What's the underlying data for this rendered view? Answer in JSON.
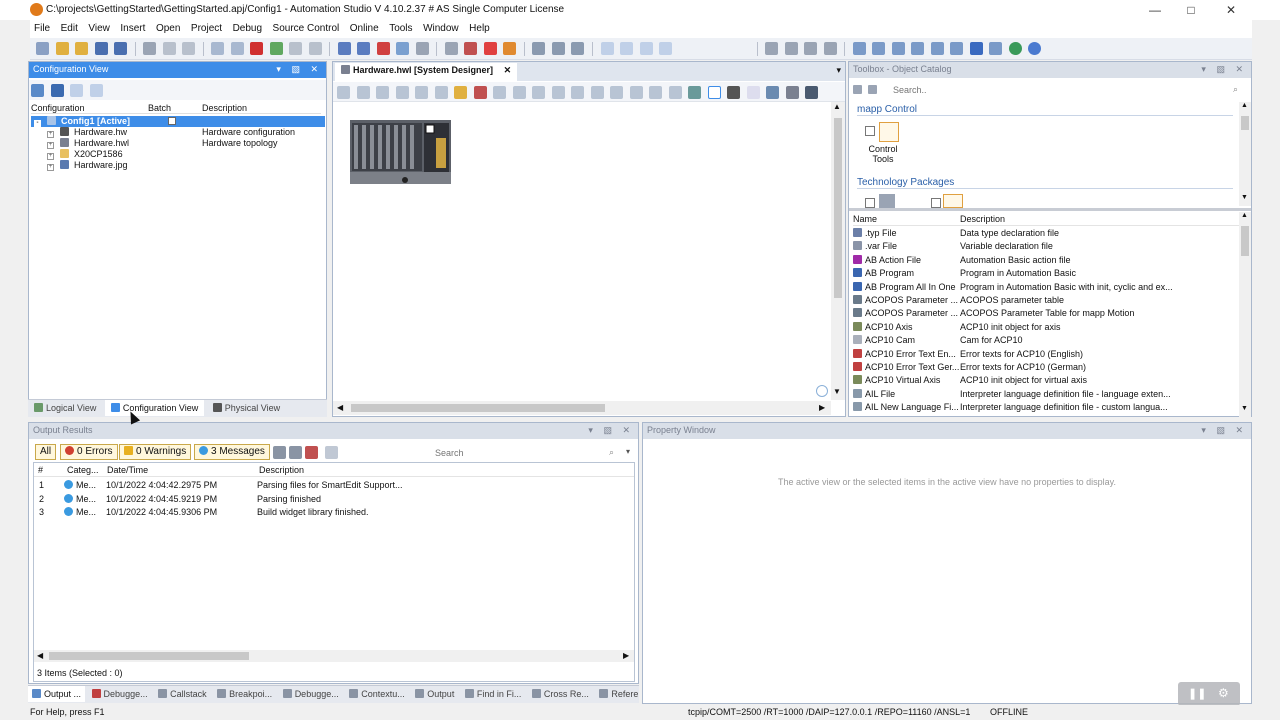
{
  "window": {
    "title": "C:\\projects\\GettingStarted\\GettingStarted.apj/Config1 - Automation Studio V 4.10.2.37 # AS Single Computer License"
  },
  "menu": [
    "File",
    "Edit",
    "View",
    "Insert",
    "Open",
    "Project",
    "Debug",
    "Source Control",
    "Online",
    "Tools",
    "Window",
    "Help"
  ],
  "config_view": {
    "title": "Configuration View",
    "columns": [
      "Configuration",
      "Batch",
      "Description"
    ],
    "rows": [
      {
        "name": "Config1 [Active]",
        "desc": ""
      },
      {
        "name": "Hardware.hw",
        "desc": "Hardware configuration"
      },
      {
        "name": "Hardware.hwl",
        "desc": "Hardware topology"
      },
      {
        "name": "X20CP1586",
        "desc": ""
      },
      {
        "name": "Hardware.jpg",
        "desc": ""
      }
    ],
    "tabs": [
      "Logical View",
      "Configuration View",
      "Physical View"
    ]
  },
  "designer": {
    "tab": "Hardware.hwl [System Designer]"
  },
  "toolbox": {
    "title": "Toolbox - Object Catalog",
    "search_placeholder": "Search..",
    "sections": [
      "mapp Control",
      "Technology Packages"
    ],
    "control_tools_label": "Control Tools",
    "columns": [
      "Name",
      "Description"
    ],
    "items": [
      {
        "name": ".typ File",
        "desc": "Data type declaration file",
        "color": "#6b7fa8"
      },
      {
        "name": ".var File",
        "desc": "Variable declaration file",
        "color": "#8a94a8"
      },
      {
        "name": "AB Action File",
        "desc": "Automation Basic action file",
        "color": "#a02aa8"
      },
      {
        "name": "AB Program",
        "desc": "Program in Automation Basic",
        "color": "#3a66b0"
      },
      {
        "name": "AB Program All In One",
        "desc": "Program in Automation Basic with init, cyclic and ex...",
        "color": "#3a66b0"
      },
      {
        "name": "ACOPOS Parameter ...",
        "desc": "ACOPOS parameter table",
        "color": "#6a7a8a"
      },
      {
        "name": "ACOPOS Parameter ...",
        "desc": "ACOPOS Parameter Table for mapp Motion",
        "color": "#6a7a8a"
      },
      {
        "name": "ACP10 Axis",
        "desc": "ACP10 init object for axis",
        "color": "#7a8a5a"
      },
      {
        "name": "ACP10 Cam",
        "desc": "Cam for ACP10",
        "color": "#aab0bb"
      },
      {
        "name": "ACP10 Error Text En...",
        "desc": "Error texts for ACP10 (English)",
        "color": "#c04040"
      },
      {
        "name": "ACP10 Error Text Ger...",
        "desc": "Error texts for ACP10 (German)",
        "color": "#c04040"
      },
      {
        "name": "ACP10 Virtual Axis",
        "desc": "ACP10 init object for virtual axis",
        "color": "#7a8a5a"
      },
      {
        "name": "AIL File",
        "desc": "Interpreter language definition file - language exten...",
        "color": "#8899aa"
      },
      {
        "name": "AIL New Language Fi...",
        "desc": "Interpreter language definition file - custom langua...",
        "color": "#8899aa"
      }
    ]
  },
  "output": {
    "title": "Output Results",
    "filters": {
      "all": "All",
      "errors": "0 Errors",
      "warnings": "0 Warnings",
      "messages": "3 Messages"
    },
    "search_placeholder": "Search",
    "columns": [
      "#",
      "Categ...",
      "Date/Time",
      "Description"
    ],
    "rows": [
      {
        "n": "1",
        "cat": "Me...",
        "time": "10/1/2022 4:04:42.2975 PM",
        "desc": "Parsing files for SmartEdit Support..."
      },
      {
        "n": "2",
        "cat": "Me...",
        "time": "10/1/2022 4:04:45.9219 PM",
        "desc": "Parsing finished"
      },
      {
        "n": "3",
        "cat": "Me...",
        "time": "10/1/2022 4:04:45.9306 PM",
        "desc": "Build widget library finished."
      }
    ],
    "footer": "3 Items (Selected : 0)",
    "bottom_tabs": [
      "Output ...",
      "Debugge...",
      "Callstack",
      "Breakpoi...",
      "Debugge...",
      "Contextu...",
      "Output",
      "Find in Fi...",
      "Cross Re...",
      "Referenc..."
    ]
  },
  "property": {
    "title": "Property Window",
    "empty_text": "The active view or the selected items in the active view have no properties to display."
  },
  "status": {
    "left": "For Help, press F1",
    "conn": "tcpip/COMT=2500 /RT=1000 /DAIP=127.0.0.1 /REPO=11160 /ANSL=1",
    "mode": "OFFLINE"
  },
  "colors": {
    "accent": "#3e8de8",
    "chip": "#fff7dc"
  }
}
